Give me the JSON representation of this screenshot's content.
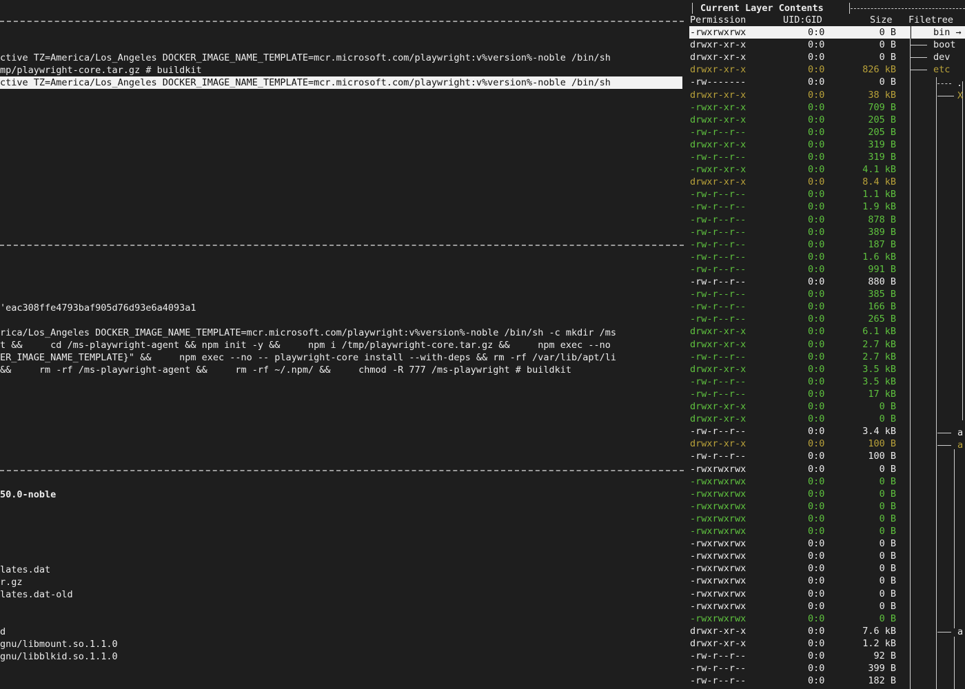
{
  "left_panel": {
    "history_lines": [
      "ctive TZ=America/Los_Angeles DOCKER_IMAGE_NAME_TEMPLATE=mcr.microsoft.com/playwright:v%version%-noble /bin/sh",
      "mp/playwright-core.tar.gz # buildkit",
      "ctive TZ=America/Los_Angeles DOCKER_IMAGE_NAME_TEMPLATE=mcr.microsoft.com/playwright:v%version%-noble /bin/sh"
    ],
    "details_lines": [
      "'eac308ffe4793baf905d76d93e6a4093a1",
      "rica/Los_Angeles DOCKER_IMAGE_NAME_TEMPLATE=mcr.microsoft.com/playwright:v%version%-noble /bin/sh -c mkdir /ms",
      "t &&     cd /ms-playwright-agent && npm init -y &&     npm i /tmp/playwright-core.tar.gz &&     npm exec --no",
      "ER_IMAGE_NAME_TEMPLATE}\" &&     npm exec --no -- playwright-core install --with-deps && rm -rf /var/lib/apt/li",
      "&&     rm -rf /ms-playwright-agent &&     rm -rf ~/.npm/ &&     chmod -R 777 /ms-playwright # buildkit"
    ],
    "image_tag": "50.0-noble",
    "wasted_lines": [
      "lates.dat",
      "r.gz",
      "lates.dat-old",
      "",
      "",
      "d",
      "gnu/libmount.so.1.1.0",
      "gnu/libblkid.so.1.1.0"
    ]
  },
  "right_panel": {
    "title": "Current Layer Contents",
    "headers": {
      "permission": "Permission",
      "uid_gid": "UID:GID",
      "size": "Size",
      "filetree": "Filetree"
    },
    "rows": [
      {
        "perm": "-rwxrwxrwx",
        "uid": "0:0",
        "size": "0 B",
        "color": "sel"
      },
      {
        "perm": "drwxr-xr-x",
        "uid": "0:0",
        "size": "0 B",
        "color": "w"
      },
      {
        "perm": "drwxr-xr-x",
        "uid": "0:0",
        "size": "0 B",
        "color": "w"
      },
      {
        "perm": "drwxr-xr-x",
        "uid": "0:0",
        "size": "826 kB",
        "color": "y"
      },
      {
        "perm": "-rw-------",
        "uid": "0:0",
        "size": "0 B",
        "color": "w"
      },
      {
        "perm": "drwxr-xr-x",
        "uid": "0:0",
        "size": "38 kB",
        "color": "y"
      },
      {
        "perm": "-rwxr-xr-x",
        "uid": "0:0",
        "size": "709 B",
        "color": "g"
      },
      {
        "perm": "drwxr-xr-x",
        "uid": "0:0",
        "size": "205 B",
        "color": "g"
      },
      {
        "perm": "-rw-r--r--",
        "uid": "0:0",
        "size": "205 B",
        "color": "g"
      },
      {
        "perm": "drwxr-xr-x",
        "uid": "0:0",
        "size": "319 B",
        "color": "g"
      },
      {
        "perm": "-rw-r--r--",
        "uid": "0:0",
        "size": "319 B",
        "color": "g"
      },
      {
        "perm": "-rwxr-xr-x",
        "uid": "0:0",
        "size": "4.1 kB",
        "color": "g"
      },
      {
        "perm": "drwxr-xr-x",
        "uid": "0:0",
        "size": "8.4 kB",
        "color": "y"
      },
      {
        "perm": "-rw-r--r--",
        "uid": "0:0",
        "size": "1.1 kB",
        "color": "g"
      },
      {
        "perm": "-rw-r--r--",
        "uid": "0:0",
        "size": "1.9 kB",
        "color": "g"
      },
      {
        "perm": "-rw-r--r--",
        "uid": "0:0",
        "size": "878 B",
        "color": "g"
      },
      {
        "perm": "-rw-r--r--",
        "uid": "0:0",
        "size": "389 B",
        "color": "g"
      },
      {
        "perm": "-rw-r--r--",
        "uid": "0:0",
        "size": "187 B",
        "color": "g"
      },
      {
        "perm": "-rw-r--r--",
        "uid": "0:0",
        "size": "1.6 kB",
        "color": "g"
      },
      {
        "perm": "-rw-r--r--",
        "uid": "0:0",
        "size": "991 B",
        "color": "g"
      },
      {
        "perm": "-rw-r--r--",
        "uid": "0:0",
        "size": "880 B",
        "color": "w"
      },
      {
        "perm": "-rw-r--r--",
        "uid": "0:0",
        "size": "385 B",
        "color": "g"
      },
      {
        "perm": "-rw-r--r--",
        "uid": "0:0",
        "size": "166 B",
        "color": "g"
      },
      {
        "perm": "-rw-r--r--",
        "uid": "0:0",
        "size": "265 B",
        "color": "g"
      },
      {
        "perm": "drwxr-xr-x",
        "uid": "0:0",
        "size": "6.1 kB",
        "color": "g"
      },
      {
        "perm": "drwxr-xr-x",
        "uid": "0:0",
        "size": "2.7 kB",
        "color": "g"
      },
      {
        "perm": "-rw-r--r--",
        "uid": "0:0",
        "size": "2.7 kB",
        "color": "g"
      },
      {
        "perm": "drwxr-xr-x",
        "uid": "0:0",
        "size": "3.5 kB",
        "color": "g"
      },
      {
        "perm": "-rw-r--r--",
        "uid": "0:0",
        "size": "3.5 kB",
        "color": "g"
      },
      {
        "perm": "-rw-r--r--",
        "uid": "0:0",
        "size": "17 kB",
        "color": "g"
      },
      {
        "perm": "drwxr-xr-x",
        "uid": "0:0",
        "size": "0 B",
        "color": "g"
      },
      {
        "perm": "drwxr-xr-x",
        "uid": "0:0",
        "size": "0 B",
        "color": "g"
      },
      {
        "perm": "-rw-r--r--",
        "uid": "0:0",
        "size": "3.4 kB",
        "color": "w"
      },
      {
        "perm": "drwxr-xr-x",
        "uid": "0:0",
        "size": "100 B",
        "color": "y"
      },
      {
        "perm": "-rw-r--r--",
        "uid": "0:0",
        "size": "100 B",
        "color": "w"
      },
      {
        "perm": "-rwxrwxrwx",
        "uid": "0:0",
        "size": "0 B",
        "color": "w"
      },
      {
        "perm": "-rwxrwxrwx",
        "uid": "0:0",
        "size": "0 B",
        "color": "g"
      },
      {
        "perm": "-rwxrwxrwx",
        "uid": "0:0",
        "size": "0 B",
        "color": "g"
      },
      {
        "perm": "-rwxrwxrwx",
        "uid": "0:0",
        "size": "0 B",
        "color": "g"
      },
      {
        "perm": "-rwxrwxrwx",
        "uid": "0:0",
        "size": "0 B",
        "color": "g"
      },
      {
        "perm": "-rwxrwxrwx",
        "uid": "0:0",
        "size": "0 B",
        "color": "g"
      },
      {
        "perm": "-rwxrwxrwx",
        "uid": "0:0",
        "size": "0 B",
        "color": "w"
      },
      {
        "perm": "-rwxrwxrwx",
        "uid": "0:0",
        "size": "0 B",
        "color": "w"
      },
      {
        "perm": "-rwxrwxrwx",
        "uid": "0:0",
        "size": "0 B",
        "color": "w"
      },
      {
        "perm": "-rwxrwxrwx",
        "uid": "0:0",
        "size": "0 B",
        "color": "w"
      },
      {
        "perm": "-rwxrwxrwx",
        "uid": "0:0",
        "size": "0 B",
        "color": "w"
      },
      {
        "perm": "-rwxrwxrwx",
        "uid": "0:0",
        "size": "0 B",
        "color": "w"
      },
      {
        "perm": "-rwxrwxrwx",
        "uid": "0:0",
        "size": "0 B",
        "color": "g"
      },
      {
        "perm": "drwxr-xr-x",
        "uid": "0:0",
        "size": "7.6 kB",
        "color": "w"
      },
      {
        "perm": "drwxr-xr-x",
        "uid": "0:0",
        "size": "1.2 kB",
        "color": "w"
      },
      {
        "perm": "-rw-r--r--",
        "uid": "0:0",
        "size": "92 B",
        "color": "w"
      },
      {
        "perm": "-rw-r--r--",
        "uid": "0:0",
        "size": "399 B",
        "color": "w"
      },
      {
        "perm": "-rw-r--r--",
        "uid": "0:0",
        "size": "182 B",
        "color": "w"
      }
    ],
    "filetree": [
      {
        "text": "bin →",
        "color": "sel"
      },
      {
        "text": "boot",
        "color": "w"
      },
      {
        "text": "dev",
        "color": "w"
      },
      {
        "text": "etc",
        "color": "y"
      }
    ],
    "filetree_fragments": [
      {
        "text": ".",
        "color": "w"
      },
      {
        "text": "X",
        "color": "y"
      },
      {
        "text": "a",
        "color": "w"
      },
      {
        "text": "a",
        "color": "y"
      },
      {
        "text": "a",
        "color": "w"
      }
    ],
    "colors": {
      "green": "#5fc23f",
      "yellow": "#b9a23a",
      "white": "#ececec",
      "background": "#1e1e1e"
    }
  }
}
